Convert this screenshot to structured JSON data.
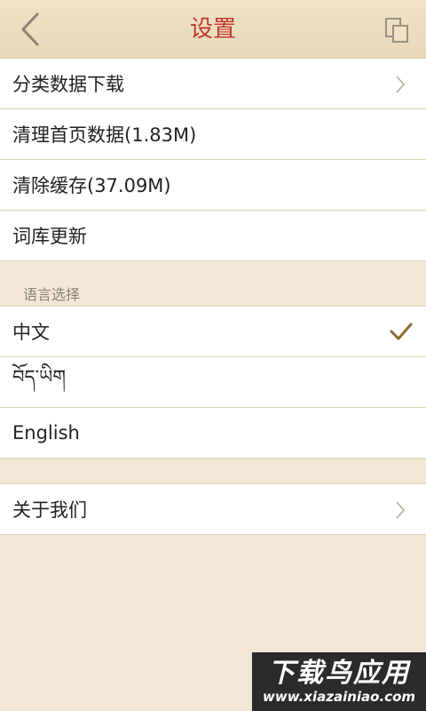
{
  "header": {
    "title": "设置"
  },
  "settings_group": {
    "items": [
      {
        "label": "分类数据下载",
        "has_chevron": true
      },
      {
        "label": "清理首页数据(1.83M)"
      },
      {
        "label": "清除缓存(37.09M)"
      },
      {
        "label": "词库更新"
      }
    ]
  },
  "language_section": {
    "title": "语言选择",
    "options": [
      {
        "label": "中文",
        "selected": true
      },
      {
        "label": "བོད་ཡིག"
      },
      {
        "label": "English"
      }
    ]
  },
  "about_group": {
    "label": "关于我们"
  },
  "watermark": {
    "main": "下载鸟应用",
    "sub": "www.xiazainiao.com"
  },
  "colors": {
    "accent": "#c0392b",
    "check": "#8b6a2e",
    "background": "#f2e7d5"
  }
}
